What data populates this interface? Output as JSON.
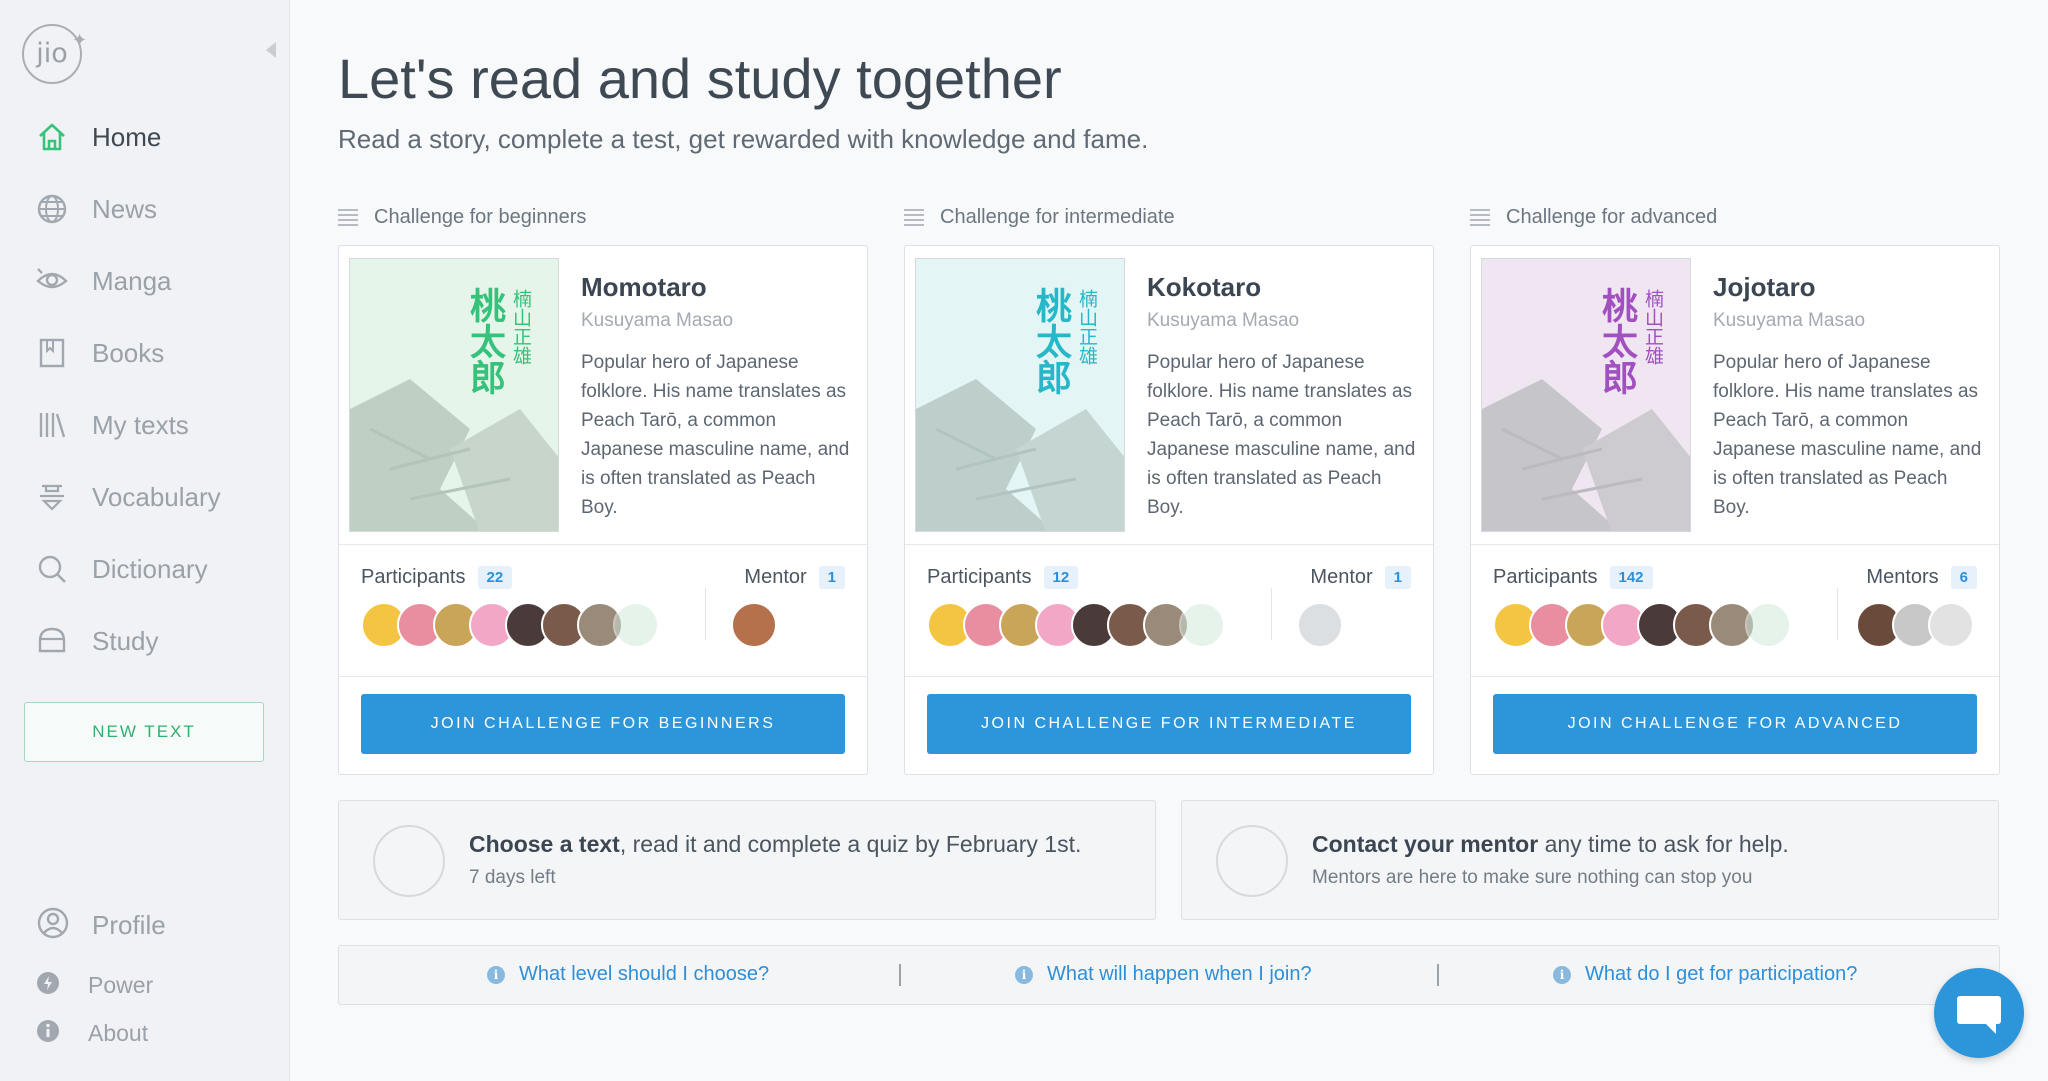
{
  "app": {
    "logo_text": "jio"
  },
  "sidebar": {
    "items": [
      {
        "label": "Home",
        "icon": "home-icon",
        "active": true
      },
      {
        "label": "News",
        "icon": "globe-icon"
      },
      {
        "label": "Manga",
        "icon": "eye-icon"
      },
      {
        "label": "Books",
        "icon": "book-icon"
      },
      {
        "label": "My texts",
        "icon": "library-icon"
      },
      {
        "label": "Vocabulary",
        "icon": "vocabulary-icon"
      },
      {
        "label": "Dictionary",
        "icon": "search-icon"
      },
      {
        "label": "Study",
        "icon": "study-icon"
      }
    ],
    "new_text_label": "NEW TEXT",
    "bottom": [
      {
        "label": "Profile",
        "icon": "profile-icon"
      },
      {
        "label": "Power",
        "icon": "power-icon"
      },
      {
        "label": "About",
        "icon": "info-icon"
      }
    ]
  },
  "header": {
    "title": "Let's read and study together",
    "subtitle": "Read a story, complete a test, get rewarded with knowledge and fame."
  },
  "challenges": [
    {
      "heading": "Challenge for beginners",
      "book_title": "Momotaro",
      "author": "Kusuyama Masao",
      "description": "Popular hero of Japanese folklore. His name translates as Peach Tarō, a common Japanese masculine name, and is often translated as Peach Boy.",
      "cover_kanji": "桃太郎",
      "cover_author_kanji": "楠山正雄",
      "participants_label": "Participants",
      "participants_count": "22",
      "mentor_label": "Mentor",
      "mentor_count": "1",
      "button": "JOIN CHALLENGE FOR BEGINNERS",
      "color": "#35c27a"
    },
    {
      "heading": "Challenge for intermediate",
      "book_title": "Kokotaro",
      "author": "Kusuyama Masao",
      "description": "Popular hero of Japanese folklore. His name translates as Peach Tarō, a common Japanese masculine name, and is often translated as Peach Boy.",
      "cover_kanji": "桃太郎",
      "cover_author_kanji": "楠山正雄",
      "participants_label": "Participants",
      "participants_count": "12",
      "mentor_label": "Mentor",
      "mentor_count": "1",
      "button": "JOIN CHALLENGE FOR INTERMEDIATE",
      "color": "#25b8c8"
    },
    {
      "heading": "Challenge for advanced",
      "book_title": "Jojotaro",
      "author": "Kusuyama Masao",
      "description": "Popular hero of Japanese folklore. His name translates as Peach Tarō, a common Japanese masculine name, and is often translated as Peach Boy.",
      "cover_kanji": "桃太郎",
      "cover_author_kanji": "楠山正雄",
      "participants_label": "Participants",
      "participants_count": "142",
      "mentor_label": "Mentors",
      "mentor_count": "6",
      "button": "JOIN CHALLENGE FOR ADVANCED",
      "color": "#a150c0"
    }
  ],
  "info": [
    {
      "bold": "Choose a text",
      "rest": ", read it and complete a quiz by February 1st.",
      "sub": "7 days left"
    },
    {
      "bold": "Contact your mentor",
      "rest": " any time to ask for help.",
      "sub": "Mentors are here to make sure nothing can stop you"
    }
  ],
  "faq": [
    "What level should I choose?",
    "What will happen when I join?",
    "What do I get for participation?"
  ],
  "colors": {
    "accent_blue": "#2d96da",
    "accent_green": "#31b071"
  }
}
